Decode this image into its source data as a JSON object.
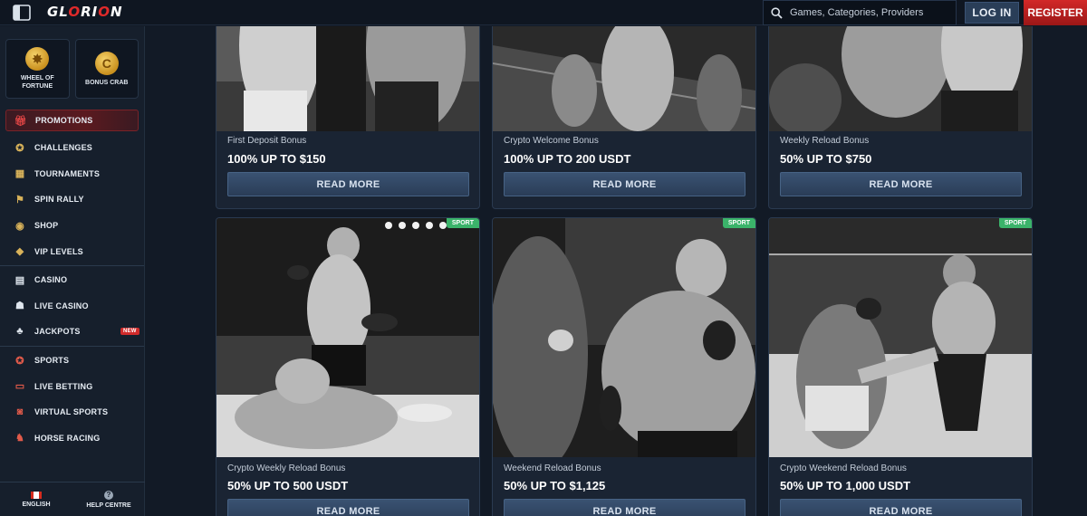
{
  "header": {
    "logo": "GLORION",
    "search_placeholder": "Games, Categories, Providers",
    "login": "LOG IN",
    "register": "REGISTER"
  },
  "sidebar": {
    "tiles": [
      {
        "label": "WHEEL OF\nFORTUNE",
        "icon": "wheel-icon"
      },
      {
        "label": "BONUS CRAB",
        "icon": "crab-icon"
      }
    ],
    "items": [
      {
        "label": "PROMOTIONS",
        "icon": "gift-icon",
        "active": true
      },
      {
        "label": "CHALLENGES",
        "icon": "medal-icon"
      },
      {
        "label": "TOURNAMENTS",
        "icon": "trophy-icon"
      },
      {
        "label": "SPIN RALLY",
        "icon": "flag-icon"
      },
      {
        "label": "SHOP",
        "icon": "basket-icon"
      },
      {
        "label": "VIP LEVELS",
        "icon": "diamond-icon"
      },
      {
        "label": "CASINO",
        "icon": "slot-icon"
      },
      {
        "label": "LIVE CASINO",
        "icon": "dealer-icon"
      },
      {
        "label": "JACKPOTS",
        "icon": "clover-icon",
        "badge": "NEW"
      },
      {
        "label": "SPORTS",
        "icon": "ball-icon"
      },
      {
        "label": "LIVE BETTING",
        "icon": "live-icon"
      },
      {
        "label": "VIRTUAL SPORTS",
        "icon": "gamepad-icon"
      },
      {
        "label": "HORSE RACING",
        "icon": "horse-icon"
      }
    ],
    "footer": {
      "language": "ENGLISH",
      "help": "HELP CENTRE"
    }
  },
  "promotions": [
    {
      "title": "First Deposit Bonus",
      "amount": "100% UP TO $150",
      "button": "READ MORE"
    },
    {
      "title": "Crypto Welcome Bonus",
      "amount": "100% UP TO 200 USDT",
      "button": "READ MORE"
    },
    {
      "title": "Weekly Reload Bonus",
      "amount": "50% UP TO $750",
      "button": "READ MORE"
    },
    {
      "title": "Crypto Weekly Reload Bonus",
      "amount": "50% UP TO 500 USDT",
      "button": "READ MORE",
      "badge": "SPORT"
    },
    {
      "title": "Weekend Reload Bonus",
      "amount": "50% UP TO $1,125",
      "button": "READ MORE",
      "badge": "SPORT"
    },
    {
      "title": "Crypto Weekend Reload Bonus",
      "amount": "50% UP TO 1,000 USDT",
      "button": "READ MORE",
      "badge": "SPORT"
    }
  ]
}
